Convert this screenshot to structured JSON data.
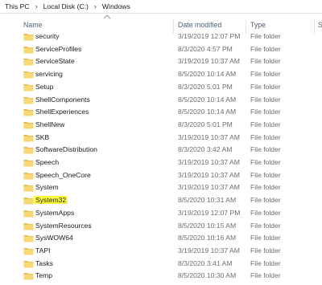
{
  "breadcrumb": [
    "This PC",
    "Local Disk (C:)",
    "Windows"
  ],
  "columns": {
    "name": "Name",
    "date": "Date modified",
    "type": "Type",
    "size": "S"
  },
  "colors": {
    "folder": "#f8d775",
    "folder_dark": "#e6b84a",
    "highlight": "#ffff3a"
  },
  "files": [
    {
      "name": "security",
      "date": "3/19/2019 12:07 PM",
      "type": "File folder"
    },
    {
      "name": "ServiceProfiles",
      "date": "8/3/2020 4:57 PM",
      "type": "File folder"
    },
    {
      "name": "ServiceState",
      "date": "3/19/2019 10:37 AM",
      "type": "File folder"
    },
    {
      "name": "servicing",
      "date": "8/5/2020 10:14 AM",
      "type": "File folder"
    },
    {
      "name": "Setup",
      "date": "8/3/2020 5:01 PM",
      "type": "File folder"
    },
    {
      "name": "ShellComponents",
      "date": "8/5/2020 10:14 AM",
      "type": "File folder"
    },
    {
      "name": "ShellExperiences",
      "date": "8/5/2020 10:14 AM",
      "type": "File folder"
    },
    {
      "name": "ShellNew",
      "date": "8/3/2020 5:01 PM",
      "type": "File folder"
    },
    {
      "name": "SKB",
      "date": "3/19/2019 10:37 AM",
      "type": "File folder"
    },
    {
      "name": "SoftwareDistribution",
      "date": "8/3/2020 3:42 AM",
      "type": "File folder"
    },
    {
      "name": "Speech",
      "date": "3/19/2019 10:37 AM",
      "type": "File folder"
    },
    {
      "name": "Speech_OneCore",
      "date": "3/19/2019 10:37 AM",
      "type": "File folder"
    },
    {
      "name": "System",
      "date": "3/19/2019 10:37 AM",
      "type": "File folder"
    },
    {
      "name": "System32",
      "date": "8/5/2020 10:31 AM",
      "type": "File folder",
      "highlight": true
    },
    {
      "name": "SystemApps",
      "date": "3/19/2019 12:07 PM",
      "type": "File folder"
    },
    {
      "name": "SystemResources",
      "date": "8/5/2020 10:15 AM",
      "type": "File folder"
    },
    {
      "name": "SysWOW64",
      "date": "8/5/2020 10:16 AM",
      "type": "File folder"
    },
    {
      "name": "TAPI",
      "date": "3/19/2019 10:37 AM",
      "type": "File folder"
    },
    {
      "name": "Tasks",
      "date": "8/3/2020 3:41 AM",
      "type": "File folder"
    },
    {
      "name": "Temp",
      "date": "8/5/2020 10:30 AM",
      "type": "File folder"
    }
  ]
}
